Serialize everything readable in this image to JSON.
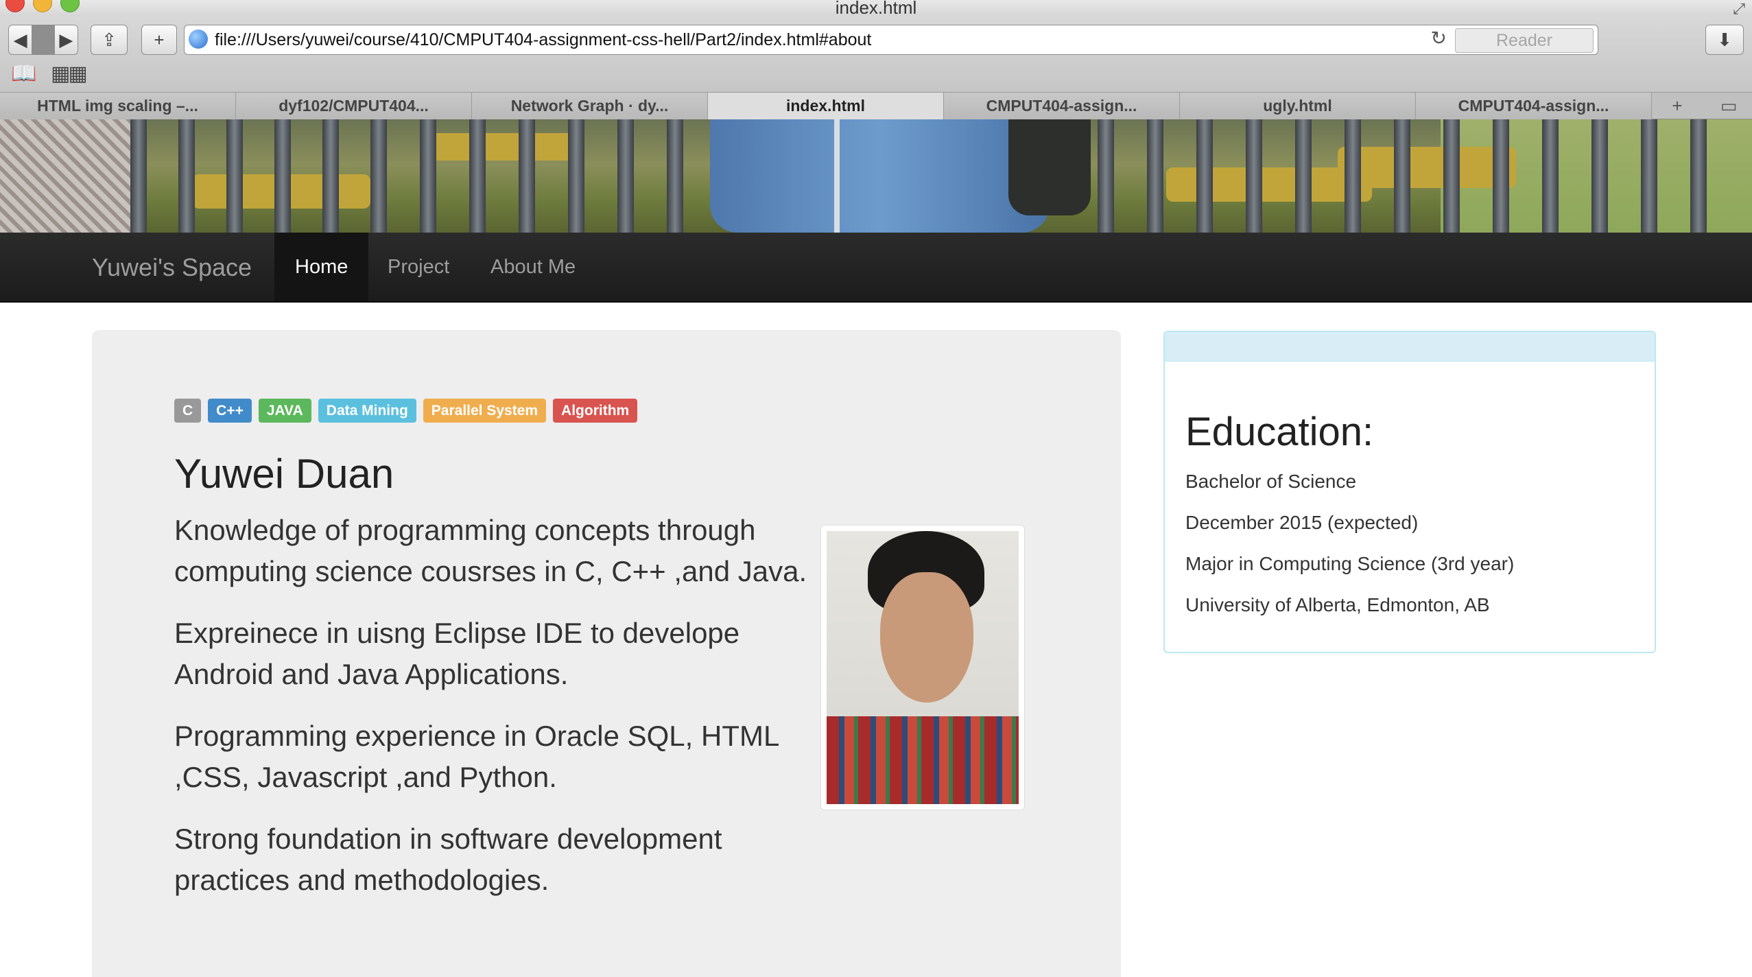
{
  "window": {
    "title": "index.html"
  },
  "toolbar": {
    "back_icon": "back-arrow-icon",
    "forward_icon": "forward-arrow-icon",
    "share_icon": "share-icon",
    "new_tab_icon": "plus-icon",
    "reader_label": "Reader",
    "url": "file:///Users/yuwei/course/410/CMPUT404-assignment-css-hell/Part2/index.html#about"
  },
  "tabs": [
    {
      "label": "HTML img scaling –..."
    },
    {
      "label": "dyf102/CMPUT404..."
    },
    {
      "label": "Network Graph · dy..."
    },
    {
      "label": "index.html"
    },
    {
      "label": "CMPUT404-assign..."
    },
    {
      "label": "ugly.html"
    },
    {
      "label": "CMPUT404-assign..."
    }
  ],
  "navbar": {
    "brand": "Yuwei's Space",
    "links": [
      {
        "label": "Home"
      },
      {
        "label": "Project"
      },
      {
        "label": "About Me"
      }
    ]
  },
  "skills": [
    {
      "label": "C",
      "color": "#999999"
    },
    {
      "label": "C++",
      "color": "#428bca"
    },
    {
      "label": "JAVA",
      "color": "#5cb85c"
    },
    {
      "label": "Data Mining",
      "color": "#5bc0de"
    },
    {
      "label": "Parallel System",
      "color": "#f0ad4e"
    },
    {
      "label": "Algorithm",
      "color": "#d9534f"
    }
  ],
  "profile": {
    "name": "Yuwei Duan",
    "paragraphs": [
      "Knowledge of programming concepts through computing science cousrses in C, C++ ,and Java.",
      "Expreinece in uisng Eclipse IDE to develope Android and Java Applications.",
      "Programming experience in Oracle SQL, HTML ,CSS, Javascript ,and Python.",
      "Strong foundation in software development practices and methodologies."
    ]
  },
  "education": {
    "title": "Education:",
    "lines": [
      "Bachelor of Science",
      "December 2015 (expected)",
      "Major in Computing Science (3rd year)",
      "University of Alberta, Edmonton, AB"
    ]
  }
}
